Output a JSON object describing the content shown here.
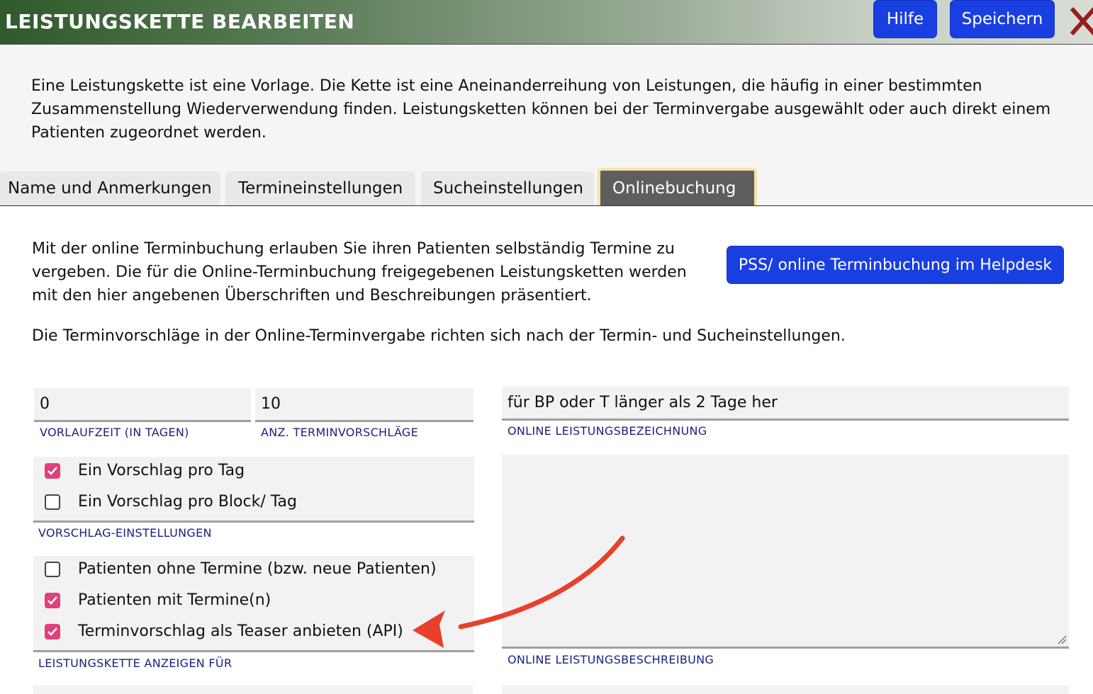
{
  "header": {
    "title": "LEISTUNGSKETTE BEARBEITEN",
    "help_label": "Hilfe",
    "save_label": "Speichern",
    "accent": "#1a3fe0",
    "close_color": "#9b1c1c"
  },
  "intro": {
    "text": "Eine Leistungskette ist eine Vorlage. Die Kette ist eine Aneinanderreihung von Leistungen, die häufig in einer bestimmten Zusammenstellung Wiederverwendung finden. Leistungsketten können bei der Terminvergabe ausgewählt oder auch direkt einem Patienten zugeordnet werden."
  },
  "tabs": [
    {
      "label": "Name und Anmerkungen"
    },
    {
      "label": "Termineinstellungen"
    },
    {
      "label": "Sucheinstellungen"
    },
    {
      "label": "Onlinebuchung",
      "active": true
    }
  ],
  "online": {
    "description": "Mit der online Terminbuchung erlauben Sie ihren Patienten selbständig Termine zu vergeben. Die für die Online-Terminbuchung freigegebenen Leistungsketten werden mit den hier angebenen Überschriften und Beschreibungen präsentiert.",
    "helpdesk_label": "PSS/ online Terminbuchung im Helpdesk",
    "note": "Die Terminvorschläge in der Online-Terminvergabe richten sich nach der Termin- und Sucheinstellungen.",
    "lead_time": {
      "value": "0",
      "label": "VORLAUFZEIT (IN TAGEN)"
    },
    "suggestions": {
      "value": "10",
      "label": "ANZ. TERMINVORSCHLÄGE"
    },
    "service_name": {
      "value": "für BP oder T länger als 2 Tage her",
      "label": "ONLINE LEISTUNGSBEZEICHNUNG"
    },
    "service_description": {
      "value": "",
      "label": "ONLINE LEISTUNGSBESCHREIBUNG"
    },
    "suggestion_settings": {
      "label": "VORSCHLAG-EINSTELLUNGEN",
      "options": [
        {
          "label": "Ein Vorschlag pro Tag",
          "checked": true
        },
        {
          "label": "Ein Vorschlag pro Block/ Tag",
          "checked": false
        }
      ]
    },
    "show_for": {
      "label": "LEISTUNGSKETTE ANZEIGEN FÜR",
      "options": [
        {
          "label": "Patienten ohne Termine (bzw. neue Patienten)",
          "checked": false
        },
        {
          "label": "Patienten mit Termine(n)",
          "checked": true
        },
        {
          "label": "Terminvorschlag als Teaser anbieten (API)",
          "checked": true
        }
      ]
    },
    "checkbox_color": "#e0407b",
    "arrow_color": "#e8402a"
  }
}
